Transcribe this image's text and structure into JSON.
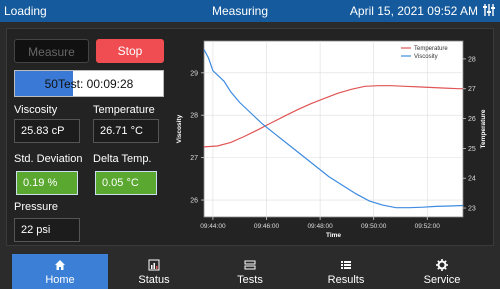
{
  "header": {
    "status": "Loading",
    "mode": "Measuring",
    "datetime": "April 15, 2021 09:52 AM",
    "settings_icon": "sliders-icon"
  },
  "controls": {
    "measure_label": "Measure",
    "stop_label": "Stop",
    "stop_color": "#ef4d52",
    "progress_text": "50Test: 00:09:28",
    "progress_value": 0.39
  },
  "readings": {
    "viscosity_label": "Viscosity",
    "viscosity_value": "25.83 cP",
    "temperature_label": "Temperature",
    "temperature_value": "26.71 °C",
    "stddev_label": "Std. Deviation",
    "stddev_value": "0.19 %",
    "delta_label": "Delta Temp.",
    "delta_value": "0.05 °C",
    "pressure_label": "Pressure",
    "pressure_value": "22 psi",
    "ok_color": "#5aa82f"
  },
  "chart_data": {
    "type": "line",
    "xlabel": "Time",
    "ylabel_left": "Viscosity",
    "ylabel_right": "Temperature",
    "x_ticks": [
      "09:44:00",
      "09:46:00",
      "09:48:00",
      "09:50:00",
      "09:52:00"
    ],
    "x_range": [
      0,
      580
    ],
    "y_left_ticks": [
      "26",
      "27",
      "28",
      "29"
    ],
    "y_left_range": [
      25.6,
      29.75
    ],
    "y_right_ticks": [
      "23",
      "24",
      "25",
      "26",
      "27",
      "28"
    ],
    "y_right_range": [
      22.7,
      28.6
    ],
    "legend_position": "top-right",
    "grid": true,
    "series": [
      {
        "name": "Temperature",
        "axis": "right",
        "color": "#e05555",
        "x": [
          0,
          30,
          60,
          90,
          120,
          150,
          180,
          210,
          240,
          270,
          300,
          330,
          360,
          390,
          420,
          450,
          480,
          510,
          540,
          570,
          580
        ],
        "y": [
          25.05,
          25.08,
          25.2,
          25.4,
          25.62,
          25.85,
          26.08,
          26.3,
          26.5,
          26.68,
          26.85,
          26.98,
          27.08,
          27.1,
          27.1,
          27.08,
          27.06,
          27.04,
          27.02,
          27.0,
          27.0
        ]
      },
      {
        "name": "Viscosity",
        "axis": "left",
        "color": "#3d8be0",
        "x": [
          0,
          10,
          20,
          30,
          45,
          60,
          80,
          100,
          130,
          160,
          190,
          220,
          250,
          280,
          310,
          340,
          370,
          400,
          430,
          460,
          490,
          520,
          550,
          580
        ],
        "y": [
          29.55,
          29.35,
          29.05,
          28.95,
          28.8,
          28.55,
          28.3,
          28.1,
          27.8,
          27.55,
          27.3,
          27.05,
          26.8,
          26.55,
          26.35,
          26.15,
          25.98,
          25.88,
          25.82,
          25.82,
          25.83,
          25.85,
          25.86,
          25.87
        ]
      }
    ]
  },
  "nav": {
    "home": "Home",
    "status": "Status",
    "tests": "Tests",
    "results": "Results",
    "service": "Service",
    "active_color": "#3b80d6"
  }
}
